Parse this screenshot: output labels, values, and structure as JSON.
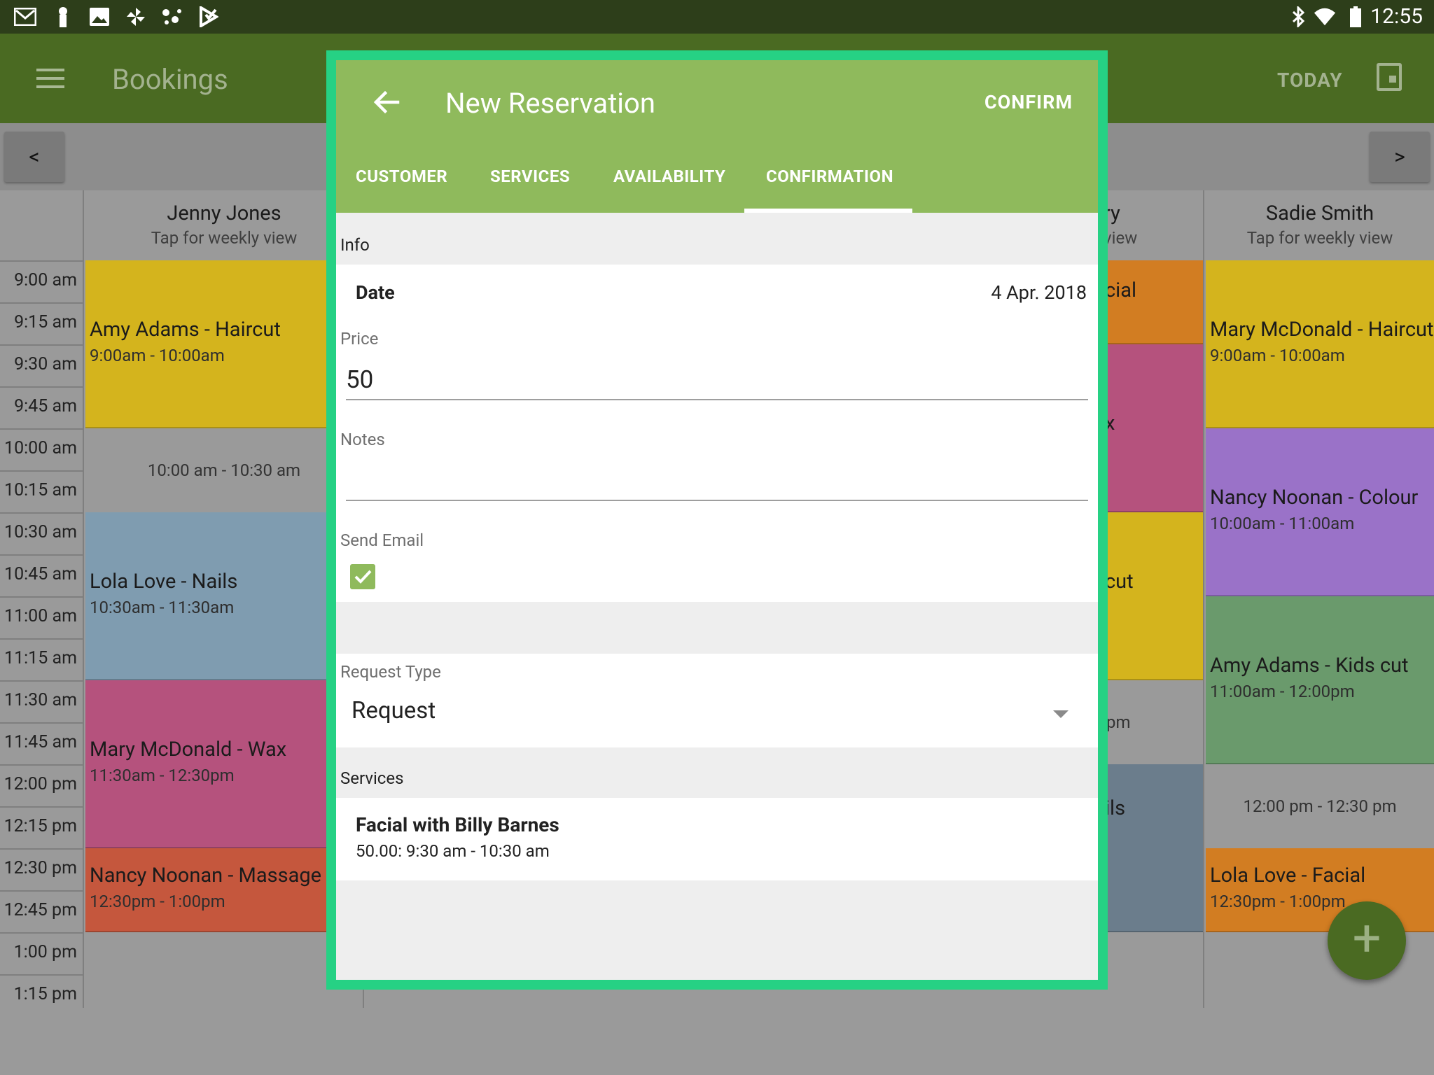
{
  "status_bar": {
    "time": "12:55",
    "left_icons": [
      "gmail-icon",
      "person-icon",
      "image-icon",
      "pinwheel-icon",
      "dots-icon",
      "play-store-icon"
    ],
    "right_icons": [
      "bluetooth-icon",
      "wifi-icon",
      "battery-icon"
    ]
  },
  "app_bar": {
    "title": "Bookings",
    "today_label": "TODAY"
  },
  "nav": {
    "prev_label": "<",
    "next_label": ">"
  },
  "times": [
    "9:00 am",
    "9:15 am",
    "9:30 am",
    "9:45 am",
    "10:00 am",
    "10:15 am",
    "10:30 am",
    "10:45 am",
    "11:00 am",
    "11:15 am",
    "11:30 am",
    "11:45 am",
    "12:00 pm",
    "12:15 pm",
    "12:30 pm",
    "12:45 pm",
    "1:00 pm",
    "1:15 pm"
  ],
  "columns": {
    "jenny": {
      "name": "Jenny Jones",
      "sub": "Tap for weekly view",
      "appts": [
        {
          "title": "Amy Adams - Haircut",
          "time": "9:00am - 10:00am"
        },
        {
          "title": "Lola Love - Nails",
          "time": "10:30am - 11:30am"
        },
        {
          "title": "Mary McDonald - Wax",
          "time": "11:30am - 12:30pm"
        },
        {
          "title": "Nancy Noonan - Massage",
          "time": "12:30pm - 1:00pm"
        }
      ],
      "free": "10:00 am - 10:30 am"
    },
    "middle": {
      "name": "ry",
      "sub": "view",
      "snippets": [
        "cial",
        "x",
        "cut",
        "pm",
        "ils"
      ]
    },
    "sadie": {
      "name": "Sadie Smith",
      "sub": "Tap for weekly view",
      "appts": [
        {
          "title": "Mary McDonald - Haircut",
          "time": "9:00am - 10:00am"
        },
        {
          "title": "Nancy Noonan - Colour",
          "time": "10:00am - 11:00am"
        },
        {
          "title": "Amy Adams - Kids cut",
          "time": "11:00am - 12:00pm"
        },
        {
          "title": "Lola Love - Facial",
          "time": "12:30pm - 1:00pm"
        }
      ],
      "free": "12:00 pm - 12:30 pm"
    }
  },
  "fab_label": "+",
  "dialog": {
    "title": "New Reservation",
    "confirm_label": "CONFIRM",
    "tabs": [
      "CUSTOMER",
      "SERVICES",
      "AVAILABILITY",
      "CONFIRMATION"
    ],
    "active_tab": "CONFIRMATION",
    "info_label": "Info",
    "date_label": "Date",
    "date_value": "4 Apr. 2018",
    "price_label": "Price",
    "price_value": "50",
    "notes_label": "Notes",
    "notes_value": "",
    "send_email_label": "Send Email",
    "send_email_checked": true,
    "request_type_label": "Request Type",
    "request_type_value": "Request",
    "services_label": "Services",
    "service": {
      "name": "Facial with Billy Barnes",
      "detail": "50.00: 9:30 am - 10:30 am"
    }
  },
  "colors": {
    "accent": "#8fba5c",
    "dialog_border": "#26d184",
    "haircut": "#d4b41d",
    "nails": "#7f9cb0",
    "wax": "#b5527d",
    "massage": "#c5573d",
    "colour": "#9a72c8",
    "kids_cut": "#6a9a6c",
    "facial": "#d27d22"
  }
}
